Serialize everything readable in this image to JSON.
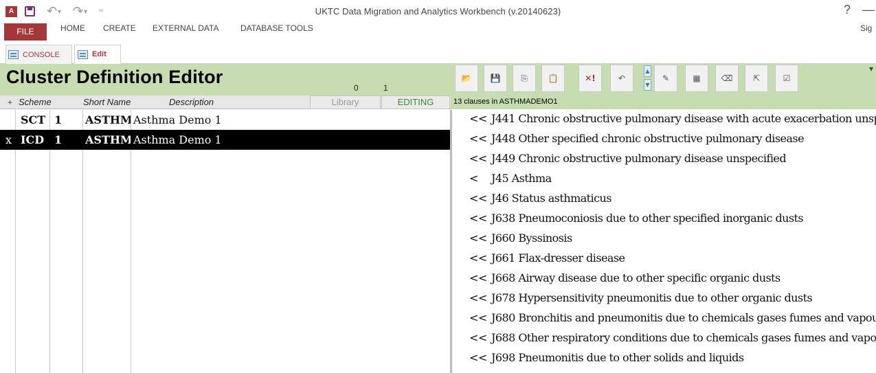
{
  "window": {
    "title": "UKTC Data Migration and Analytics Workbench (v.20140623)",
    "app_icon": "A",
    "help_label": "?",
    "minimize_label": "—"
  },
  "ribbon": {
    "file_label": "FILE",
    "tabs": [
      "HOME",
      "CREATE",
      "EXTERNAL DATA",
      "DATABASE TOOLS"
    ],
    "sign_in": "Sig"
  },
  "doc_tabs": {
    "console": "CONSOLE",
    "edit": "Edit"
  },
  "editor": {
    "title": "Cluster Definition Editor",
    "counter_a": "0",
    "counter_b": "1",
    "add_label": "+",
    "columns": {
      "scheme": "Scheme",
      "short_name": "Short Name",
      "description": "Description"
    },
    "library_label": "Library",
    "editing_label": "EDITING",
    "rows": [
      {
        "marker": "",
        "scheme": "SCT",
        "version": "1",
        "short_name": "ASTHMAD",
        "description": "Asthma Demo 1",
        "selected": false
      },
      {
        "marker": "x",
        "scheme": "ICD",
        "version": "1",
        "short_name": "ASTHMAD",
        "description": "Asthma Demo 1",
        "selected": true
      }
    ]
  },
  "toolbar": {
    "buttons": [
      {
        "name": "open-folder-icon",
        "glyph": "📂"
      },
      {
        "name": "save-icon",
        "glyph": "💾"
      },
      {
        "name": "copy-icon",
        "glyph": "⎘"
      },
      {
        "name": "paste-icon",
        "glyph": "📋"
      },
      {
        "name": "delete-icon",
        "glyph": "✕!"
      },
      {
        "name": "undo-icon",
        "glyph": "↶"
      },
      {
        "name": "pencil-icon",
        "glyph": "✎"
      },
      {
        "name": "database-icon",
        "glyph": "▦"
      },
      {
        "name": "erase-icon",
        "glyph": "⌫"
      },
      {
        "name": "export-icon",
        "glyph": "⇱"
      },
      {
        "name": "check-icon",
        "glyph": "☑"
      }
    ],
    "move_up": "▲",
    "move_down": "▼",
    "caret": "▾"
  },
  "clauses": {
    "count_text": "13 clauses in ASTHMADEMO1",
    "items": [
      {
        "op": "<<",
        "code": "J441",
        "text": "Chronic obstructive pulmonary disease with acute exacerbation  unspecified"
      },
      {
        "op": "<<",
        "code": "J448",
        "text": "Other specified chronic obstructive pulmonary disease"
      },
      {
        "op": "<<",
        "code": "J449",
        "text": "Chronic obstructive pulmonary disease  unspecified"
      },
      {
        "op": "<",
        "code": "J45",
        "text": "Asthma"
      },
      {
        "op": "<<",
        "code": "J46",
        "text": "Status asthmaticus"
      },
      {
        "op": "<<",
        "code": "J638",
        "text": "Pneumoconiosis due to other specified inorganic dusts"
      },
      {
        "op": "<<",
        "code": "J660",
        "text": "Byssinosis"
      },
      {
        "op": "<<",
        "code": "J661",
        "text": "Flax-dresser disease"
      },
      {
        "op": "<<",
        "code": "J668",
        "text": "Airway disease due to other specific organic dusts"
      },
      {
        "op": "<<",
        "code": "J678",
        "text": "Hypersensitivity pneumonitis due to other organic dusts"
      },
      {
        "op": "<<",
        "code": "J680",
        "text": "Bronchitis and pneumonitis due to chemicals  gases  fumes and vapours"
      },
      {
        "op": "<<",
        "code": "J688",
        "text": "Other respiratory conditions due to chemicals  gases  fumes and vapours"
      },
      {
        "op": "<<",
        "code": "J698",
        "text": "Pneumonitis due to other solids and liquids"
      }
    ]
  }
}
